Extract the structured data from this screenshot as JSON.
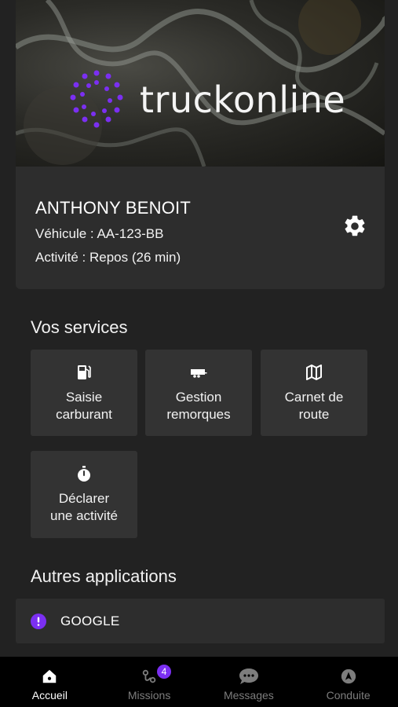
{
  "brand": {
    "name": "truckonline",
    "accent": "#7b2ff2"
  },
  "profile": {
    "driver_name": "ANTHONY BENOIT",
    "vehicle": "Véhicule : AA-123-BB",
    "activity": "Activité : Repos (26 min)",
    "settings_icon": "gear-icon"
  },
  "services": {
    "title": "Vos services",
    "items": [
      {
        "label": "Saisie\ncarburant",
        "icon": "fuel-pump-icon"
      },
      {
        "label": "Gestion\nremorques",
        "icon": "trailer-icon"
      },
      {
        "label": "Carnet de\nroute",
        "icon": "map-icon"
      },
      {
        "label": "Déclarer\nune activité",
        "icon": "stopwatch-icon"
      }
    ]
  },
  "other_apps": {
    "title": "Autres applications",
    "items": [
      {
        "label": "GOOGLE",
        "icon": "alert-circle-icon"
      }
    ]
  },
  "nav": {
    "items": [
      {
        "label": "Accueil",
        "icon": "home-icon",
        "active": true
      },
      {
        "label": "Missions",
        "icon": "route-icon",
        "badge": "4"
      },
      {
        "label": "Messages",
        "icon": "chat-icon"
      },
      {
        "label": "Conduite",
        "icon": "navigation-icon"
      }
    ]
  }
}
